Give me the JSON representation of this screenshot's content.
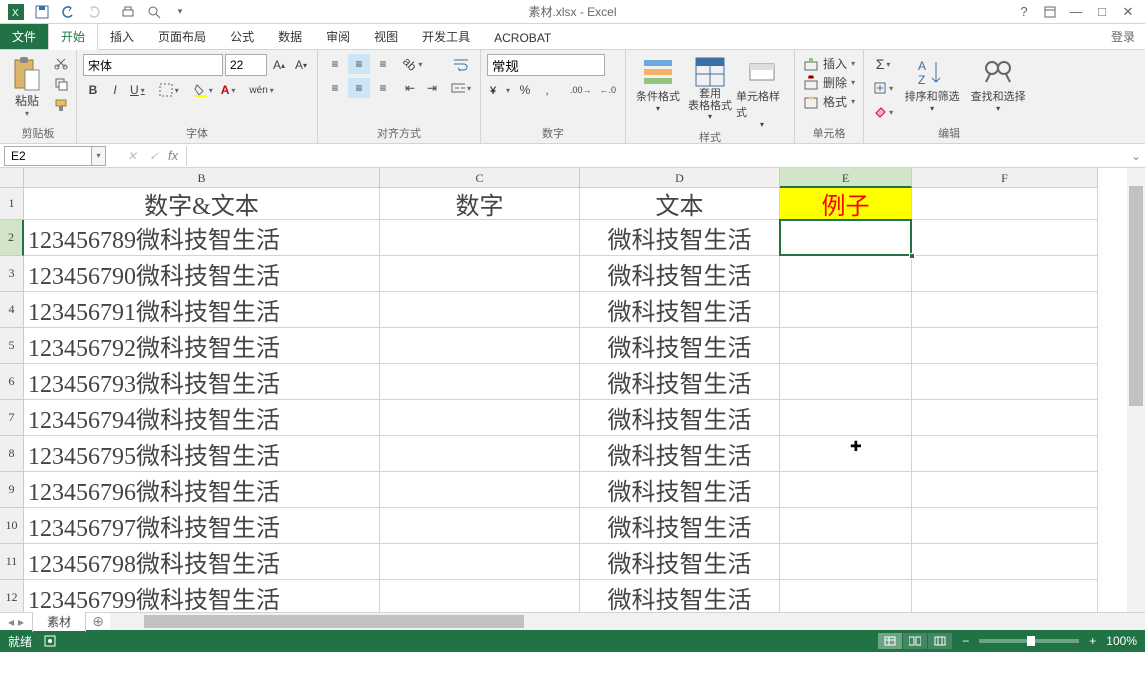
{
  "title": "素材.xlsx - Excel",
  "login": "登录",
  "tabs": {
    "file": "文件",
    "home": "开始",
    "insert": "插入",
    "layout": "页面布局",
    "formula": "公式",
    "data": "数据",
    "review": "审阅",
    "view": "视图",
    "dev": "开发工具",
    "acrobat": "ACROBAT"
  },
  "groups": {
    "clipboard": "剪贴板",
    "font": "字体",
    "align": "对齐方式",
    "number": "数字",
    "styles": "样式",
    "cells": "单元格",
    "editing": "编辑"
  },
  "ribbon": {
    "paste": "粘贴",
    "font_name": "宋体",
    "font_size": "22",
    "bold": "B",
    "italic": "I",
    "underline": "U",
    "number_format": "常规",
    "cond_format": "条件格式",
    "table_format": "套用\n表格格式",
    "cell_style": "单元格样式",
    "insert": "插入",
    "delete": "删除",
    "format": "格式",
    "sort_filter": "排序和筛选",
    "find_select": "查找和选择"
  },
  "namebox": "E2",
  "fx": "fx",
  "columns": [
    "B",
    "C",
    "D",
    "E",
    "F"
  ],
  "col_widths": {
    "B": 356,
    "C": 200,
    "D": 200,
    "E": 132,
    "F": 186
  },
  "headers": {
    "B": "数字&文本",
    "C": "数字",
    "D": "文本",
    "E": "例子"
  },
  "rows": [
    {
      "n": 1
    },
    {
      "n": 2,
      "B": "123456789微科技智生活",
      "D": "微科技智生活"
    },
    {
      "n": 3,
      "B": "123456790微科技智生活",
      "D": "微科技智生活"
    },
    {
      "n": 4,
      "B": "123456791微科技智生活",
      "D": "微科技智生活"
    },
    {
      "n": 5,
      "B": "123456792微科技智生活",
      "D": "微科技智生活"
    },
    {
      "n": 6,
      "B": "123456793微科技智生活",
      "D": "微科技智生活"
    },
    {
      "n": 7,
      "B": "123456794微科技智生活",
      "D": "微科技智生活"
    },
    {
      "n": 8,
      "B": "123456795微科技智生活",
      "D": "微科技智生活"
    },
    {
      "n": 9,
      "B": "123456796微科技智生活",
      "D": "微科技智生活"
    },
    {
      "n": 10,
      "B": "123456797微科技智生活",
      "D": "微科技智生活"
    },
    {
      "n": 11,
      "B": "123456798微科技智生活",
      "D": "微科技智生活"
    },
    {
      "n": 12,
      "B": "123456799微科技智生活",
      "D": "微科技智生活"
    }
  ],
  "sheet": "素材",
  "status": "就绪",
  "zoom": "100%"
}
